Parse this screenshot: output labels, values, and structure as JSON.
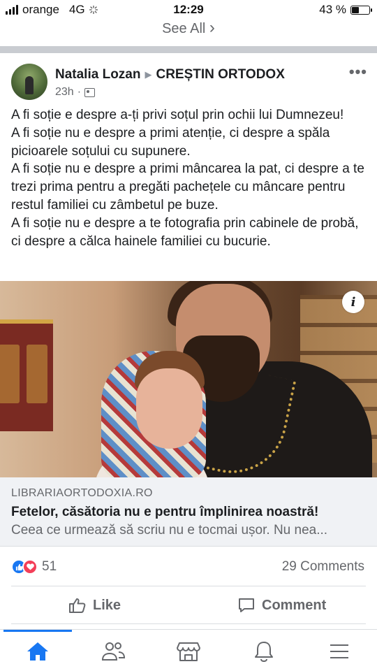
{
  "status_bar": {
    "carrier": "orange",
    "network": "4G",
    "time": "12:29",
    "battery": "43 %",
    "battery_level": 0.43
  },
  "see_all": {
    "label": "See All",
    "chevron": "›"
  },
  "post": {
    "author": "Natalia Lozan",
    "group": "CREȘTIN ORTODOX",
    "time": "23h",
    "text": [
      "A fi soție e despre a-ți privi soțul prin ochii lui Dumnezeu!",
      "A fi soție nu e despre a primi atenție, ci despre a spăla picioarele soțului cu supunere.",
      "A fi soție nu e despre a primi mâncarea la pat, ci despre a te trezi prima pentru a pregăti pachețele cu mâncare pentru restul familiei cu zâmbetul pe buze.",
      "A fi soție nu e despre a te fotografia prin cabinele de probă, ci despre a călca hainele familiei cu bucurie."
    ],
    "icons": {
      "audience": "group-icon",
      "more": "more-options-icon",
      "info": "info-icon"
    }
  },
  "link": {
    "domain": "LIBRARIAORTODOXIA.RO",
    "title": "Fetelor, căsătoria nu e pentru împlinirea noastră!",
    "description": "Ceea ce urmează să scriu nu e tocmai ușor. Nu nea..."
  },
  "stats": {
    "reactions_count": "51",
    "comments": "29 Comments"
  },
  "actions": {
    "like": "Like",
    "comment": "Comment"
  },
  "nav": {
    "items": [
      "home-icon",
      "friends-icon",
      "marketplace-icon",
      "notifications-icon",
      "menu-icon"
    ],
    "active": "home-icon"
  },
  "colors": {
    "accent": "#1877f2",
    "love": "#f33e58",
    "muted_text": "#65676b",
    "text": "#1c1e21",
    "caption_bg": "#f0f2f5"
  }
}
